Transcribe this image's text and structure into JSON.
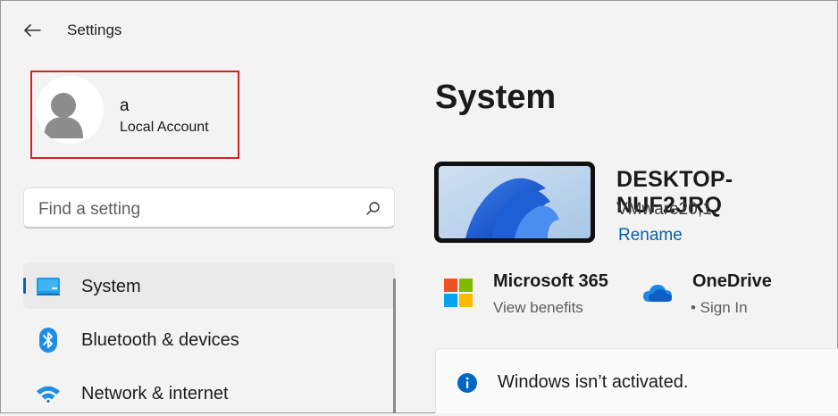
{
  "window": {
    "title": "Settings"
  },
  "account": {
    "name": "a",
    "type": "Local Account"
  },
  "search": {
    "placeholder": "Find a setting"
  },
  "sidebar": {
    "items": [
      {
        "label": "System",
        "icon": "system-monitor-icon",
        "selected": true
      },
      {
        "label": "Bluetooth & devices",
        "icon": "bluetooth-icon",
        "selected": false
      },
      {
        "label": "Network & internet",
        "icon": "wifi-icon",
        "selected": false
      }
    ]
  },
  "main": {
    "title": "System",
    "device": {
      "name": "DESKTOP-NUF2JRQ",
      "model": "VMware20,1",
      "rename_label": "Rename"
    },
    "apps": [
      {
        "title": "Microsoft 365",
        "subtitle": "View benefits",
        "icon": "microsoft-logo-icon"
      },
      {
        "title": "OneDrive",
        "subtitle": "• Sign In",
        "icon": "onedrive-cloud-icon"
      }
    ],
    "banner": {
      "text": "Windows isn’t activated.",
      "icon": "info-icon"
    }
  },
  "colors": {
    "accent": "#0067c0",
    "link": "#0a5fa8",
    "highlight_border": "#d42222"
  }
}
